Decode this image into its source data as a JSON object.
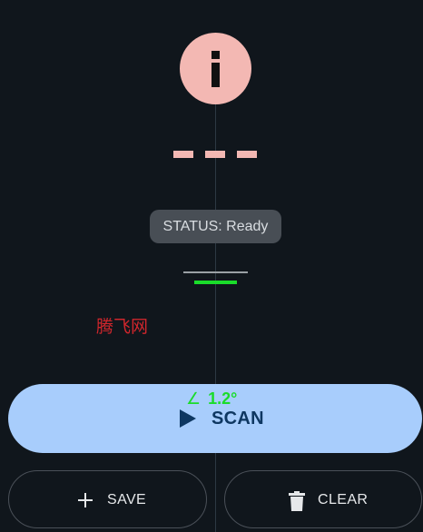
{
  "status": {
    "label": "STATUS: Ready"
  },
  "reading": {
    "display": "- - -"
  },
  "angle": {
    "symbol": "∠",
    "value": "1.2°"
  },
  "watermark": {
    "text": "腾飞网"
  },
  "actions": {
    "scan_label": "SCAN",
    "save_label": "SAVE",
    "clear_label": "CLEAR"
  },
  "icons": {
    "info": "info-icon",
    "play": "play-icon",
    "plus": "plus-icon",
    "trash": "trash-icon"
  },
  "colors": {
    "background": "#10161c",
    "accent_pink": "#f3b8b3",
    "level_green": "#1adc2a",
    "scan_button": "#a8cdfc",
    "scan_text": "#0e3761",
    "watermark_red": "#d0262c"
  }
}
